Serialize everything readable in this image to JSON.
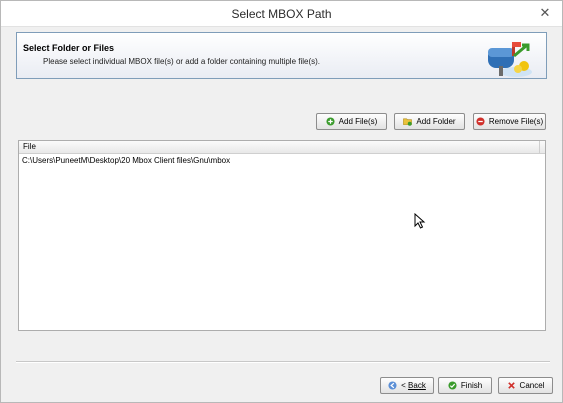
{
  "window": {
    "title": "Select MBOX Path"
  },
  "header": {
    "title": "Select Folder or Files",
    "description": "Please select individual MBOX file(s) or add a folder containing multiple file(s)."
  },
  "toolbar": {
    "add_files_label": "Add File(s)",
    "add_folder_label": "Add Folder",
    "remove_files_label": "Remove File(s)"
  },
  "file_list": {
    "column_header": "File",
    "rows": [
      "C:\\Users\\PuneetM\\Desktop\\20 Mbox Client files\\Gnu\\mbox"
    ]
  },
  "footer": {
    "back_prefix": "< ",
    "back_label": "Back",
    "finish_label": "Finish",
    "cancel_label": "Cancel"
  },
  "icons": {
    "close": "close-icon",
    "add_files": "plus-circle-icon",
    "add_folder": "folder-plus-icon",
    "remove_files": "remove-circle-icon",
    "back": "back-arrow-icon",
    "finish": "check-circle-icon",
    "cancel": "x-icon",
    "header": "mailbox-icon"
  },
  "colors": {
    "add_green": "#3a9b2c",
    "remove_red": "#d0302b",
    "folder_yellow": "#e9c23b",
    "header_border": "#7f9db9"
  }
}
